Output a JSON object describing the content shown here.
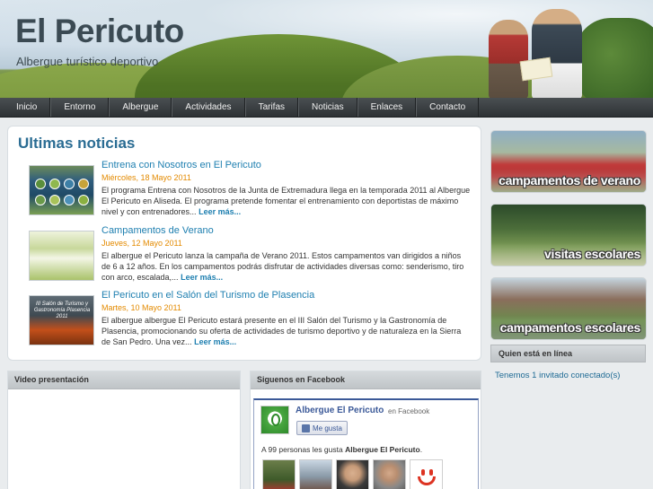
{
  "header": {
    "title": "El Pericuto",
    "tagline": "Albergue turístico deportivo"
  },
  "nav": {
    "items": [
      "Inicio",
      "Entorno",
      "Albergue",
      "Actividades",
      "Tarifas",
      "Noticias",
      "Enlaces",
      "Contacto"
    ]
  },
  "news": {
    "heading": "Ultimas noticias",
    "more_label": "Leer más...",
    "items": [
      {
        "title": "Entrena con Nosotros en El Pericuto",
        "date": "Miércoles, 18 Mayo 2011",
        "text": "El programa Entrena con Nosotros de la Junta de Extremadura llega en la temporada 2011 al Albergue El Pericuto en Aliseda. El programa pretende fomentar el entrenamiento con deportistas de máximo nivel y con entrenadores..."
      },
      {
        "title": "Campamentos de Verano",
        "date": "Jueves, 12 Mayo 2011",
        "text": "El albergue el Pericuto lanza la campaña de Verano 2011. Estos campamentos van dirigidos a niños de 6 a 12 años. En los campamentos podrás disfrutar de actividades diversas como: senderismo, tiro con arco, escalada,..."
      },
      {
        "title": "El Pericuto en el Salón del Turismo de Plasencia",
        "date": "Martes, 10 Mayo 2011",
        "text": "El albergue albergue El Pericuto estará presente en el III Salón del Turismo y la Gastronomía de Plasencia, promocionando su oferta de actividades de turismo deportivo y de naturaleza en la Sierra de San Pedro. Una vez..."
      }
    ],
    "thumb3_caption": "III Salón de Turismo y Gastronomía Plasencia 2011"
  },
  "banners": [
    {
      "label": "campamentos de verano"
    },
    {
      "label": "visitas escolares"
    },
    {
      "label": "campamentos escolares"
    }
  ],
  "online": {
    "heading": "Quien está en línea",
    "text": "Tenemos 1 invitado conectado(s)"
  },
  "video": {
    "heading": "Video presentación"
  },
  "facebook": {
    "heading": "Siguenos en Facebook",
    "page_name": "Albergue El Pericuto",
    "on_facebook": "en Facebook",
    "like_label": "Me gusta",
    "count_prefix": "A 99 personas les gusta ",
    "count_name": "Albergue El Pericuto",
    "count_suffix": "."
  }
}
